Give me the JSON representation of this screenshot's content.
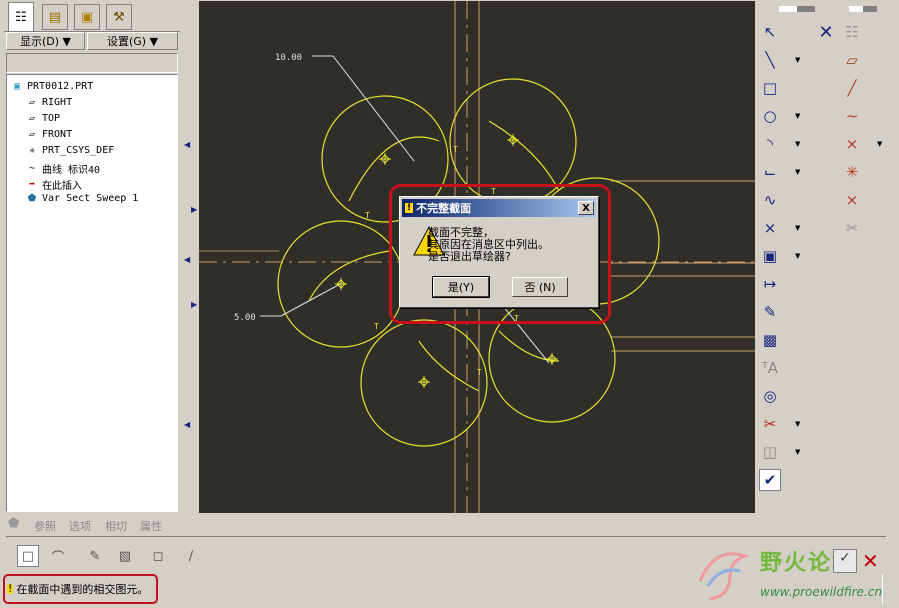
{
  "left_panel": {
    "tabs": [
      {
        "icon": "model-tree-icon"
      },
      {
        "icon": "layers-icon"
      },
      {
        "icon": "folder-icon"
      },
      {
        "icon": "favorites-icon"
      }
    ],
    "show_label": "显示",
    "show_key": "(D)",
    "settings_label": "设置",
    "settings_key": "(G)",
    "tree": [
      {
        "label": "PRT0012.PRT",
        "icon": "part-icon"
      },
      {
        "label": "RIGHT",
        "icon": "datum-plane-icon"
      },
      {
        "label": "TOP",
        "icon": "datum-plane-icon"
      },
      {
        "label": "FRONT",
        "icon": "datum-plane-icon"
      },
      {
        "label": "PRT_CSYS_DEF",
        "icon": "csys-icon"
      },
      {
        "label": "曲线 标识40",
        "icon": "curve-icon"
      },
      {
        "label": "在此插入",
        "icon": "insert-here-icon"
      },
      {
        "label": "Var Sect Sweep 1",
        "icon": "sweep-icon"
      }
    ]
  },
  "canvas": {
    "dimensions": [
      "10.00",
      "5.00"
    ],
    "tangent_mark": "T",
    "colors": {
      "background": "#2f2e29",
      "geometry": "#e8e330",
      "construction": "#c8a070"
    }
  },
  "dialog": {
    "title": "不完整截面",
    "close_label": "X",
    "lines": [
      "截面不完整，",
      "其原因在消息区中列出。",
      "是否退出草绘器?"
    ],
    "yes_label": "是",
    "yes_key": "(Y)",
    "no_label": "否",
    "no_key": "(N)"
  },
  "dashboard": {
    "tabs": [
      "参照",
      "选项",
      "相切",
      "属性"
    ]
  },
  "status": {
    "message": "在截面中遇到的相交图元。",
    "icon": "warning-icon",
    "highlight_color": "#c8101a"
  },
  "watermark": {
    "title": "野火论坛",
    "url": "www.proewildfire.cn"
  },
  "right_toolbar": {
    "confirm_icon": "check-icon",
    "cancel_icon": "close-icon"
  }
}
